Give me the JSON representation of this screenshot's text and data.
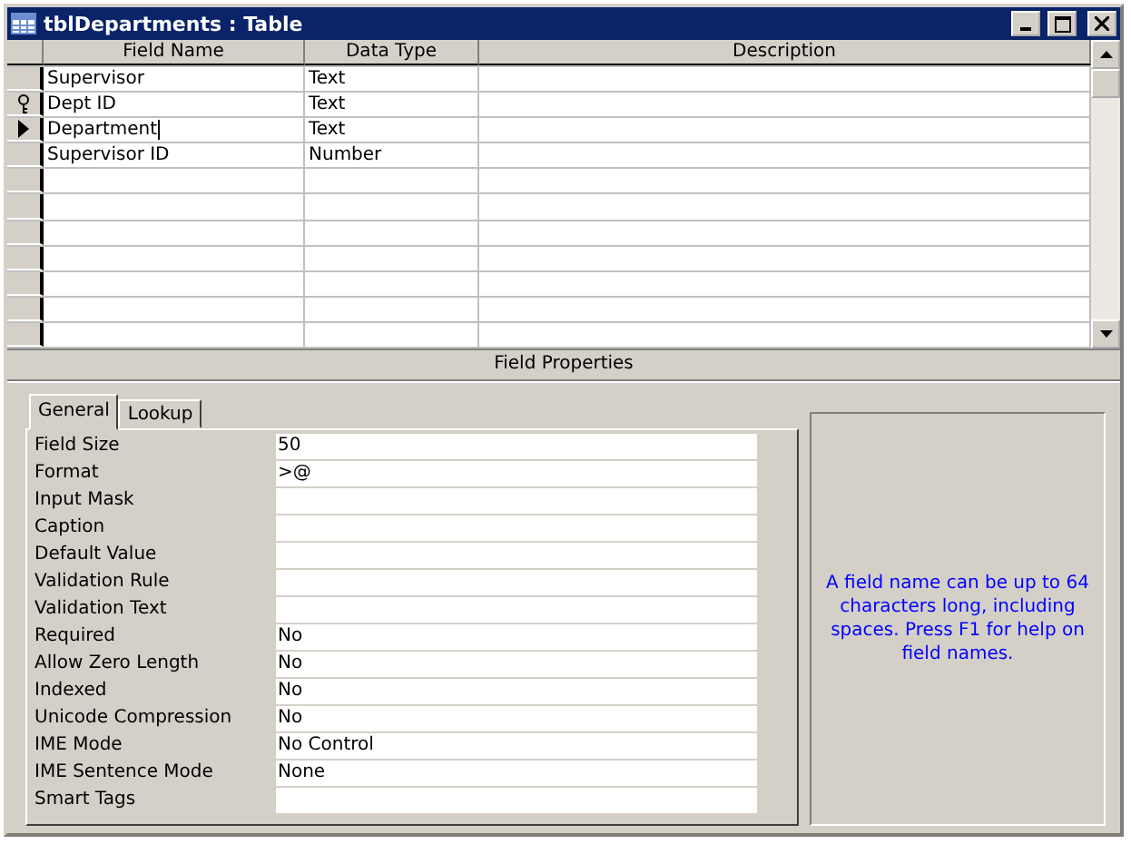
{
  "window": {
    "title": "tblDepartments : Table"
  },
  "columns": [
    "Field Name",
    "Data Type",
    "Description"
  ],
  "fields": [
    {
      "name": "Supervisor",
      "type": "Text",
      "primary_key": false,
      "current": false
    },
    {
      "name": "Dept ID",
      "type": "Text",
      "primary_key": true,
      "current": false
    },
    {
      "name": "Department",
      "type": "Text",
      "primary_key": false,
      "current": true
    },
    {
      "name": "Supervisor ID",
      "type": "Number",
      "primary_key": false,
      "current": false
    }
  ],
  "properties_title": "Field Properties",
  "tabs": [
    {
      "label": "General",
      "selected": true
    },
    {
      "label": "Lookup",
      "selected": false
    }
  ],
  "properties": [
    {
      "label": "Field Size",
      "value": "50"
    },
    {
      "label": "Format",
      "value": ">@"
    },
    {
      "label": "Input Mask"
    },
    {
      "label": "Caption"
    },
    {
      "label": "Default Value"
    },
    {
      "label": "Validation Rule"
    },
    {
      "label": "Validation Text"
    },
    {
      "label": "Required",
      "value": "No"
    },
    {
      "label": "Allow Zero Length",
      "value": "No"
    },
    {
      "label": "Indexed",
      "value": "No"
    },
    {
      "label": "Unicode Compression",
      "value": "No"
    },
    {
      "label": "IME Mode",
      "value": "No Control"
    },
    {
      "label": "IME Sentence Mode",
      "value": "None"
    },
    {
      "label": "Smart Tags"
    }
  ],
  "help_text": "A field name can be up to 64 characters long, including spaces.  Press F1 for help on field names."
}
